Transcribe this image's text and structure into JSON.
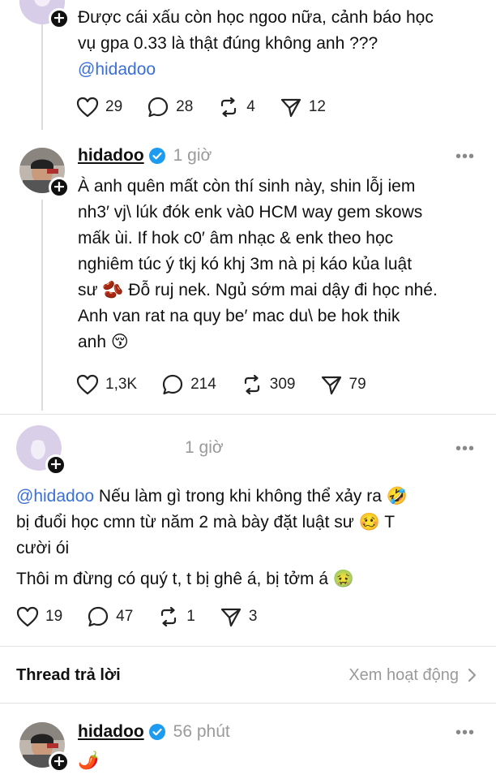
{
  "posts": [
    {
      "text_lines": [
        "Được cái xấu còn học ngoo nữa, cảnh báo học",
        "vụ gpa 0.33 là thật đúng không anh ???"
      ],
      "mention": "@hidadoo",
      "likes": "29",
      "replies": "28",
      "reposts": "4",
      "shares": "12"
    },
    {
      "username": "hidadoo",
      "time": "1 giờ",
      "text_lines": [
        "À anh quên mất còn thí sinh này, shin lỗj iem",
        "nh3′ vj\\ lúk đók enk và0 HCM way gem skows",
        "mấk ùi. If hok c0′ âm nhạc & enk theo học",
        "nghiêm túc ý tkj kó khj 3m nà pị káo kủa luật",
        "sư 🫘 Đỗ ruj nek. Ngủ sớm mai dậy đi học nhé.",
        "Anh van rat na quy be′ mac du\\ be hok thik",
        "anh 😚"
      ],
      "likes": "1,3K",
      "replies": "214",
      "reposts": "309",
      "shares": "79"
    },
    {
      "time": "1 giờ",
      "mention": "@hidadoo",
      "text_lines": [
        " Nếu làm gì trong khi không thể xảy ra 🤣",
        "bị đuổi học cmn từ năm 2 mà bày đặt luật sư 🥴 T",
        "cười ói"
      ],
      "text_line2": "Thôi m đừng có quý t, t bị ghê á, bị tởm á 🤢",
      "likes": "19",
      "replies": "47",
      "reposts": "1",
      "shares": "3"
    },
    {
      "username": "hidadoo",
      "time": "56 phút",
      "text": "🌶️"
    }
  ],
  "reply_bar": {
    "title": "Thread trả lời",
    "link": "Xem hoạt động"
  },
  "icons": [
    "heart-icon",
    "comment-icon",
    "repost-icon",
    "share-icon",
    "verified-icon",
    "more-icon",
    "follow-plus-icon",
    "chevron-right-icon"
  ],
  "colors": {
    "mention": "#3a6fd8",
    "verified": "#1d9bf0",
    "muted": "#9a9a9a"
  }
}
